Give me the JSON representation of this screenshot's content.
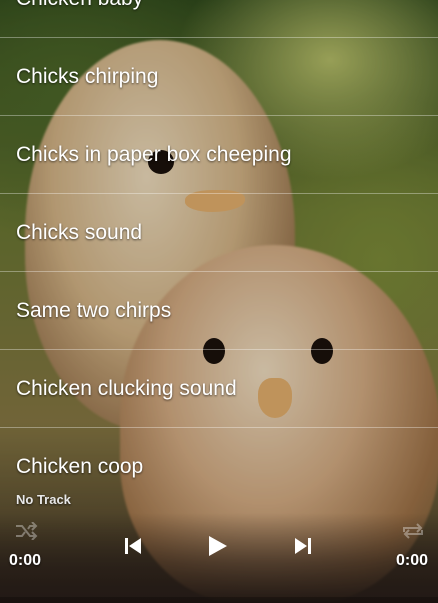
{
  "playlist": {
    "items": [
      {
        "label": "Chicken baby"
      },
      {
        "label": "Chicks chirping"
      },
      {
        "label": "Chicks in paper box cheeping"
      },
      {
        "label": "Chicks sound"
      },
      {
        "label": "Same two chirps"
      },
      {
        "label": "Chicken clucking sound"
      },
      {
        "label": "Chicken coop"
      }
    ]
  },
  "player": {
    "track_title": "No Track",
    "elapsed": "0:00",
    "duration": "0:00",
    "progress_fraction": 0,
    "icons": {
      "prev": "skip-previous-icon",
      "play": "play-icon",
      "next": "skip-next-icon",
      "shuffle": "shuffle-icon",
      "repeat": "repeat-icon"
    }
  }
}
